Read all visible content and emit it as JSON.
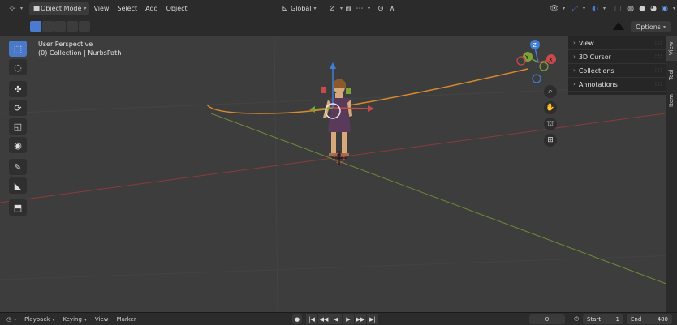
{
  "header": {
    "mode": "Object Mode",
    "menus": [
      "View",
      "Select",
      "Add",
      "Object"
    ],
    "orientation": "Global",
    "options": "Options"
  },
  "viewport": {
    "perspective": "User Perspective",
    "collection": "(0) Collection | NurbsPath"
  },
  "sidebar": {
    "panels": [
      "View",
      "3D Cursor",
      "Collections",
      "Annotations"
    ],
    "tabs": [
      "Item",
      "Tool",
      "View"
    ],
    "active_tab": "View"
  },
  "timeline": {
    "menus": [
      "Playback",
      "Keying",
      "View",
      "Marker"
    ],
    "current_frame": "0",
    "start_label": "Start",
    "start_value": "1",
    "end_label": "End",
    "end_value": "480"
  },
  "colors": {
    "accent": "#4a79c9",
    "x_axis": "#c94a4a",
    "y_axis": "#7fa13a",
    "z_axis": "#3f7fd6",
    "path": "#d98a2c"
  }
}
